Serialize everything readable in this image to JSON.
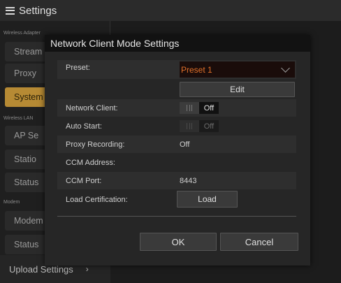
{
  "topbar": {
    "title": "Settings"
  },
  "sidebar": {
    "groups": [
      "Wireless Adapter",
      "Wireless LAN",
      "Modem"
    ],
    "items": [
      "Stream",
      "Proxy",
      "System",
      "AP Se",
      "Statio",
      "Status",
      "Modem",
      "Status"
    ],
    "upload": "Upload Settings"
  },
  "dialog": {
    "title": "Network Client Mode Settings",
    "preset": {
      "label": "Preset:",
      "value": "Preset 1"
    },
    "edit": "Edit",
    "network_client": {
      "label": "Network Client:",
      "state": "Off"
    },
    "auto_start": {
      "label": "Auto Start:",
      "state": "Off"
    },
    "proxy_recording": {
      "label": "Proxy Recording:",
      "value": "Off"
    },
    "ccm_address": {
      "label": "CCM Address:",
      "value": ""
    },
    "ccm_port": {
      "label": "CCM Port:",
      "value": "8443"
    },
    "load_cert": {
      "label": "Load Certification:",
      "button": "Load"
    },
    "ok": "OK",
    "cancel": "Cancel"
  },
  "colors": {
    "accent": "#b68a34",
    "preset_text": "#e0702a"
  }
}
